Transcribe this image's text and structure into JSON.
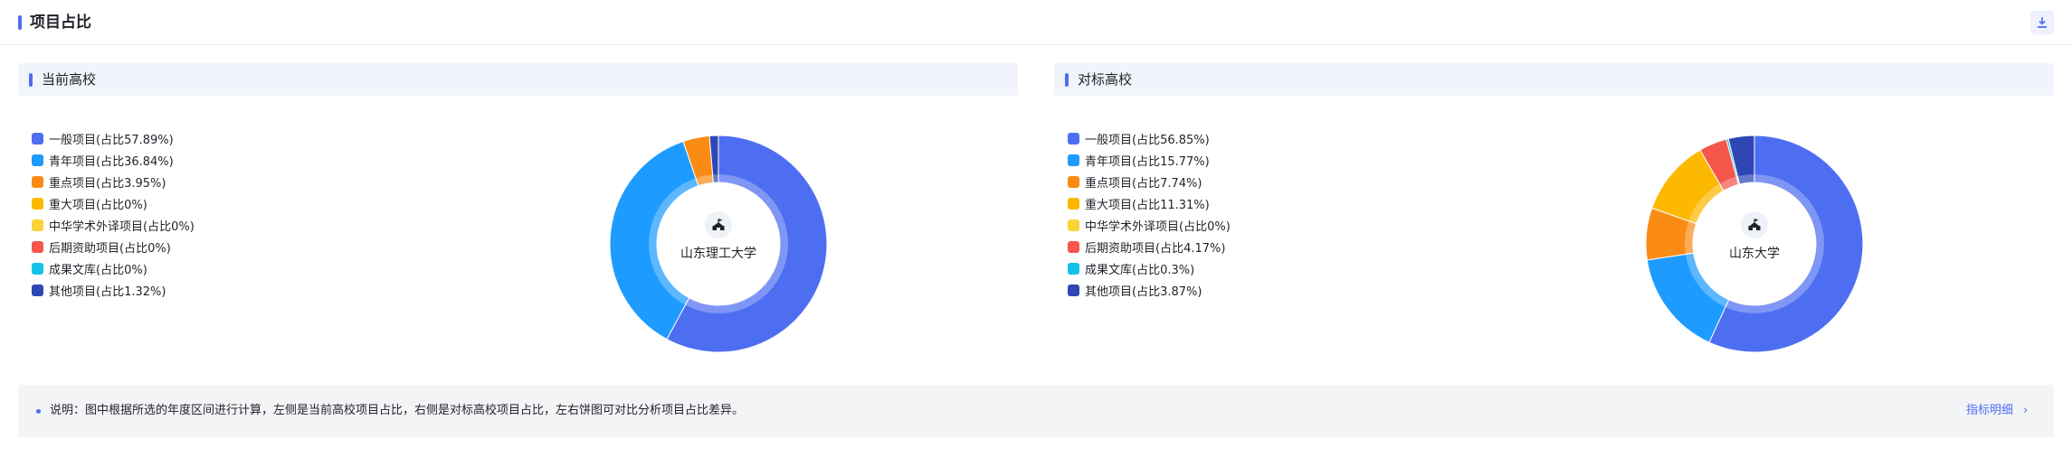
{
  "header": {
    "title": "项目占比",
    "download_icon": "download-icon"
  },
  "note": {
    "text": "说明：图中根据所选的年度区间进行计算，左侧是当前高校项目占比，右侧是对标高校项目占比，左右饼图可对比分析项目占比差异。",
    "link": "指标明细",
    "chevron": "›"
  },
  "chart_data": [
    {
      "type": "pie",
      "variant": "donut",
      "panel_title": "当前高校",
      "center_label": "山东理工大学",
      "center_icon": "university-icon",
      "legend_position": "left",
      "series": [
        {
          "name": "一般项目",
          "label": "一般项目(占比57.89%)",
          "value": 57.89,
          "color": "#4e6ef2"
        },
        {
          "name": "青年项目",
          "label": "青年项目(占比36.84%)",
          "value": 36.84,
          "color": "#1e9bff"
        },
        {
          "name": "重点项目",
          "label": "重点项目(占比3.95%)",
          "value": 3.95,
          "color": "#fa8c16"
        },
        {
          "name": "重大项目",
          "label": "重大项目(占比0%)",
          "value": 0,
          "color": "#fcb900"
        },
        {
          "name": "中华学术外译项目",
          "label": "中华学术外译项目(占比0%)",
          "value": 0,
          "color": "#fad337"
        },
        {
          "name": "后期资助项目",
          "label": "后期资助项目(占比0%)",
          "value": 0,
          "color": "#f5574b"
        },
        {
          "name": "成果文库",
          "label": "成果文库(占比0%)",
          "value": 0,
          "color": "#13c2e8"
        },
        {
          "name": "其他项目",
          "label": "其他项目(占比1.32%)",
          "value": 1.32,
          "color": "#2f47b5"
        }
      ]
    },
    {
      "type": "pie",
      "variant": "donut",
      "panel_title": "对标高校",
      "center_label": "山东大学",
      "center_icon": "university-icon",
      "legend_position": "left",
      "series": [
        {
          "name": "一般项目",
          "label": "一般项目(占比56.85%)",
          "value": 56.85,
          "color": "#4e6ef2"
        },
        {
          "name": "青年项目",
          "label": "青年项目(占比15.77%)",
          "value": 15.77,
          "color": "#1e9bff"
        },
        {
          "name": "重点项目",
          "label": "重点项目(占比7.74%)",
          "value": 7.74,
          "color": "#fa8c16"
        },
        {
          "name": "重大项目",
          "label": "重大项目(占比11.31%)",
          "value": 11.31,
          "color": "#fcb900"
        },
        {
          "name": "中华学术外译项目",
          "label": "中华学术外译项目(占比0%)",
          "value": 0,
          "color": "#fad337"
        },
        {
          "name": "后期资助项目",
          "label": "后期资助项目(占比4.17%)",
          "value": 4.17,
          "color": "#f5574b"
        },
        {
          "name": "成果文库",
          "label": "成果文库(占比0.3%)",
          "value": 0.3,
          "color": "#13c2e8"
        },
        {
          "name": "其他项目",
          "label": "其他项目(占比3.87%)",
          "value": 3.87,
          "color": "#2f47b5"
        }
      ]
    }
  ]
}
